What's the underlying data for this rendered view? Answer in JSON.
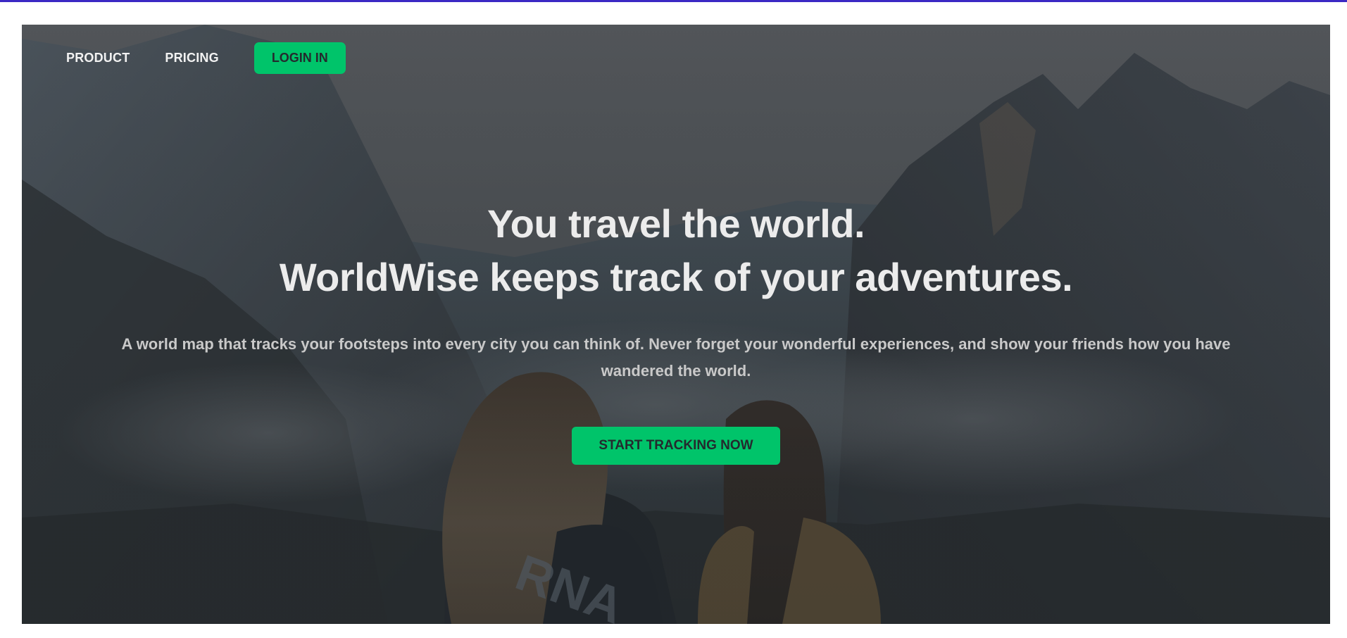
{
  "nav": {
    "items": [
      {
        "label": "PRODUCT"
      },
      {
        "label": "PRICING"
      }
    ],
    "login_label": "LOGIN IN"
  },
  "hero": {
    "headline_line1": "You travel the world.",
    "headline_line2": "WorldWise keeps track of your adventures.",
    "subtitle": "A world map that tracks your footsteps into every city you can think of. Never forget your wonderful experiences, and show your friends how you have wandered the world.",
    "cta_label": "START TRACKING NOW"
  },
  "colors": {
    "accent_bar": "#3b28c4",
    "brand_green": "#00c46a",
    "dark_text": "#242a2e",
    "light_text": "#ececec"
  }
}
